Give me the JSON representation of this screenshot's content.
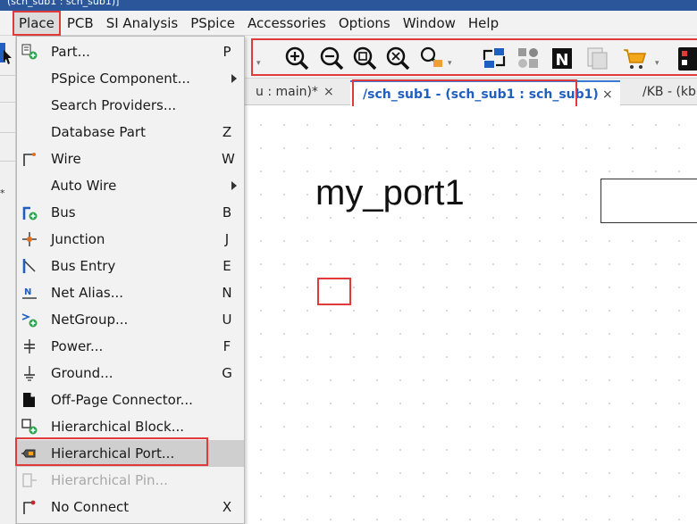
{
  "title_bar": {
    "text": "(sch_sub1 : sch_sub1)]"
  },
  "menubar": {
    "items": [
      "Place",
      "PCB",
      "SI Analysis",
      "PSpice",
      "Accessories",
      "Options",
      "Window",
      "Help"
    ],
    "active": "Place"
  },
  "tabs": {
    "partial_left": "u : main)*",
    "active": "/sch_sub1 - (sch_sub1 : sch_sub1)",
    "partial_right": "/KB - (kb",
    "close_glyph": "×"
  },
  "toolbar": {
    "icons": [
      "zoom-in-icon",
      "zoom-out-icon",
      "zoom-area-icon",
      "zoom-all-icon",
      "zoom-select-icon",
      "annotate-icon",
      "bom-icon",
      "netlist-icon",
      "cross-probe-icon",
      "cart-icon",
      "color-icon"
    ],
    "dropdown_glyph": "▾"
  },
  "canvas": {
    "port_label": "my_port1"
  },
  "sidebar": {
    "marker": "*"
  },
  "place_menu": {
    "items": [
      {
        "label": "Part...",
        "shortcut": "P",
        "icon": "part-icon"
      },
      {
        "label": "PSpice Component...",
        "shortcut": "",
        "icon": "",
        "submenu": true
      },
      {
        "label": "Search Providers...",
        "shortcut": "",
        "icon": ""
      },
      {
        "label": "Database Part",
        "shortcut": "Z",
        "icon": ""
      },
      {
        "label": "Wire",
        "shortcut": "W",
        "icon": "wire-icon"
      },
      {
        "label": "Auto Wire",
        "shortcut": "",
        "icon": "",
        "submenu": true
      },
      {
        "label": "Bus",
        "shortcut": "B",
        "icon": "bus-icon"
      },
      {
        "label": "Junction",
        "shortcut": "J",
        "icon": "junction-icon"
      },
      {
        "label": "Bus Entry",
        "shortcut": "E",
        "icon": "bus-entry-icon"
      },
      {
        "label": "Net Alias...",
        "shortcut": "N",
        "icon": "net-alias-icon"
      },
      {
        "label": "NetGroup...",
        "shortcut": "U",
        "icon": "netgroup-icon"
      },
      {
        "label": "Power...",
        "shortcut": "F",
        "icon": "power-icon"
      },
      {
        "label": "Ground...",
        "shortcut": "G",
        "icon": "ground-icon"
      },
      {
        "label": "Off-Page Connector...",
        "shortcut": "",
        "icon": "off-page-connector-icon"
      },
      {
        "label": "Hierarchical Block...",
        "shortcut": "",
        "icon": "hierarchical-block-icon"
      },
      {
        "label": "Hierarchical Port...",
        "shortcut": "",
        "icon": "hierarchical-port-icon",
        "highlighted": true
      },
      {
        "label": "Hierarchical Pin...",
        "shortcut": "",
        "icon": "hierarchical-pin-icon",
        "disabled": true
      },
      {
        "label": "No Connect",
        "shortcut": "X",
        "icon": "no-connect-icon"
      }
    ]
  },
  "colors": {
    "menu_bg": "#f2f2f2",
    "highlight": "#cfcfcf",
    "annotation_red": "#e03a3a",
    "active_tab_text": "#1f5fbf"
  }
}
